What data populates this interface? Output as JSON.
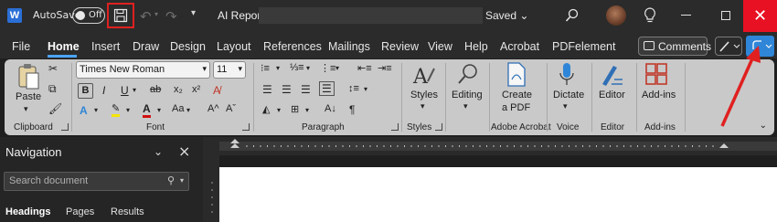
{
  "titlebar": {
    "app_icon_letter": "W",
    "autosave_label": "AutoSave",
    "autosave_state": "Off",
    "document_title": "AI Report",
    "save_status": "Saved",
    "close_glyph": "✕"
  },
  "menu": {
    "items": [
      "File",
      "Home",
      "Insert",
      "Draw",
      "Design",
      "Layout",
      "References",
      "Mailings",
      "Review",
      "View",
      "Help",
      "Acrobat",
      "PDFelement"
    ],
    "active": "Home",
    "comments_label": "Comments"
  },
  "ribbon": {
    "clipboard": {
      "paste": "Paste",
      "group": "Clipboard"
    },
    "font": {
      "name": "Times New Roman",
      "size": "11",
      "group": "Font"
    },
    "paragraph": {
      "group": "Paragraph"
    },
    "styles": {
      "label": "Styles",
      "group": "Styles"
    },
    "editing": {
      "label": "Editing"
    },
    "acrobat": {
      "label_line1": "Create",
      "label_line2": "a PDF",
      "group": "Adobe Acrobat"
    },
    "voice": {
      "label": "Dictate",
      "group": "Voice"
    },
    "editor": {
      "label": "Editor",
      "group": "Editor"
    },
    "addins": {
      "label": "Add-ins",
      "group": "Add-ins"
    }
  },
  "navigation": {
    "title": "Navigation",
    "search_placeholder": "Search document",
    "tabs": [
      "Headings",
      "Pages",
      "Results"
    ],
    "active_tab": "Headings"
  },
  "colors": {
    "close_red": "#e81123",
    "highlight_red": "#e02020",
    "accent_blue": "#2f86d8",
    "ribbon_bg": "#c9c9c9"
  },
  "icons": [
    "word-icon",
    "save-icon",
    "undo-icon",
    "redo-icon",
    "search-icon",
    "lightbulb-icon",
    "minimize-icon",
    "maximize-icon",
    "close-icon",
    "comment-icon",
    "pen-icon",
    "share-icon",
    "paste-icon",
    "cut-icon",
    "copy-icon",
    "format-painter-icon",
    "styles-icon",
    "editing-icon",
    "create-pdf-icon",
    "microphone-icon",
    "editor-icon",
    "add-ins-icon",
    "red-arrow-annotation"
  ]
}
